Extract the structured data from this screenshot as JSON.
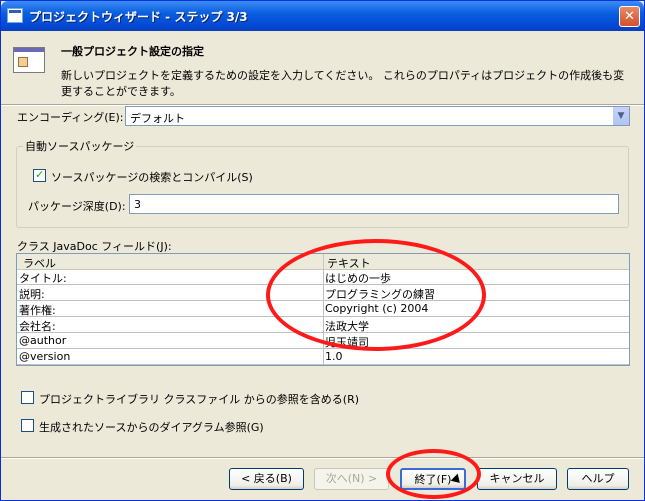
{
  "window": {
    "title": "プロジェクトウィザード - ステップ 3/3",
    "close_label": "✕"
  },
  "header": {
    "title": "一般プロジェクト設定の指定",
    "description": "新しいプロジェクトを定義するための設定を入力してください。 これらのプロパティはプロジェクトの作成後も変更することができます。"
  },
  "encoding": {
    "label": "エンコーディング(E):",
    "value": "デフォルト"
  },
  "auto_source": {
    "group_title": "自動ソースパッケージ",
    "checkbox_label": "ソースパッケージの検索とコンパイル(S)",
    "checked": true,
    "depth_label": "パッケージ深度(D):",
    "depth_value": "3"
  },
  "javadoc": {
    "label": "クラス JavaDoc フィールド(J):",
    "columns": [
      "ラベル",
      "テキスト"
    ],
    "rows": [
      {
        "label": "タイトル:",
        "text": "はじめの一歩"
      },
      {
        "label": "説明:",
        "text": "プログラミングの練習"
      },
      {
        "label": "著作権:",
        "text": "Copyright (c) 2004"
      },
      {
        "label": "会社名:",
        "text": "法政大学"
      },
      {
        "label": "@author",
        "text": "児玉靖司"
      },
      {
        "label": "@version",
        "text": "1.0"
      }
    ]
  },
  "options": {
    "include_library_refs": "プロジェクトライブラリ クラスファイル からの参照を含める(R)",
    "diagram_refs": "生成されたソースからのダイアグラム参照(G)"
  },
  "buttons": {
    "back": "< 戻る(B)",
    "next": "次へ(N) >",
    "finish": "終了(F)",
    "cancel": "キャンセル",
    "help": "ヘルプ"
  },
  "colors": {
    "annotation": "#ff1a1a",
    "title_bar": "#0a5fe0"
  }
}
